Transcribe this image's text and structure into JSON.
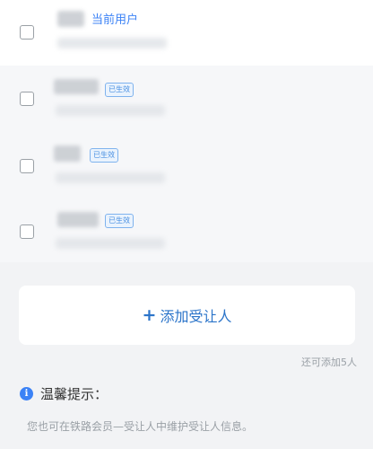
{
  "recipients": [
    {
      "is_current": true,
      "current_label": "当前用户",
      "badge": ""
    },
    {
      "is_current": false,
      "current_label": "",
      "badge": "已生效"
    },
    {
      "is_current": false,
      "current_label": "",
      "badge": "已生效"
    },
    {
      "is_current": false,
      "current_label": "",
      "badge": "已生效"
    }
  ],
  "add_button": {
    "icon": "plus-icon",
    "label": "添加受让人"
  },
  "remaining_text": "还可添加5人",
  "tips": {
    "icon": "info-icon",
    "title": "温馨提示：",
    "body": "您也可在铁路会员—受让人中维护受让人信息。"
  },
  "colors": {
    "accent": "#3b82f6",
    "button_text": "#2b74c9",
    "badge_border": "#7fb3ee"
  }
}
